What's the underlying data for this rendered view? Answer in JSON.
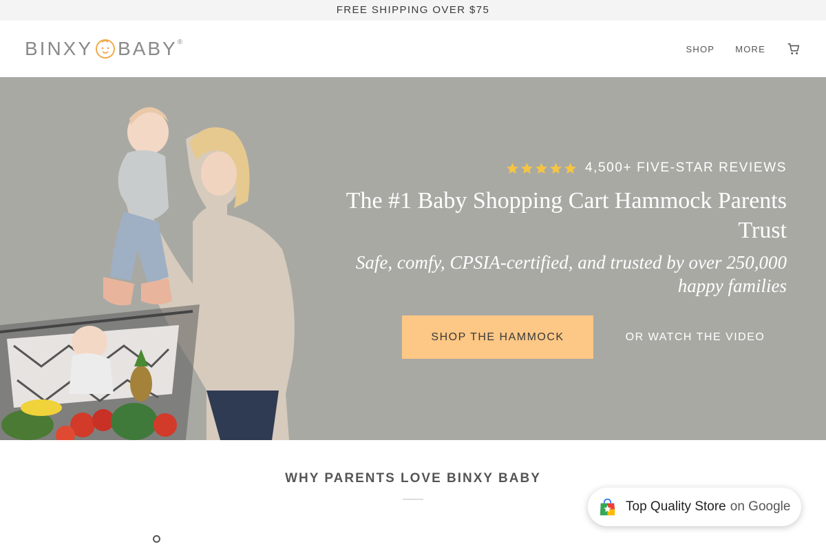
{
  "announcement": {
    "text": "FREE SHIPPING OVER $75"
  },
  "header": {
    "logo": {
      "left": "BINXY",
      "right": "BABY",
      "registered": "®"
    },
    "nav": {
      "shop": "SHOP",
      "more": "MORE"
    },
    "cart_icon": "cart-icon"
  },
  "hero": {
    "rating": {
      "stars": 5,
      "text": "4,500+ FIVE-STAR REVIEWS",
      "star_color": "#f5c542"
    },
    "title": "The #1 Baby Shopping Cart Hammock Parents Trust",
    "subtitle": "Safe, comfy, CPSIA-certified, and trusted by over 250,000 happy families",
    "primary_button": "SHOP THE HAMMOCK",
    "secondary_link": "OR WATCH THE VIDEO",
    "background_color": "#a9a9a4",
    "button_color": "#fdc785"
  },
  "section": {
    "title": "WHY PARENTS LOVE BINXY BABY"
  },
  "google_badge": {
    "strong": "Top Quality Store",
    "light": "on Google",
    "icon": "shopping-bag-icon"
  }
}
